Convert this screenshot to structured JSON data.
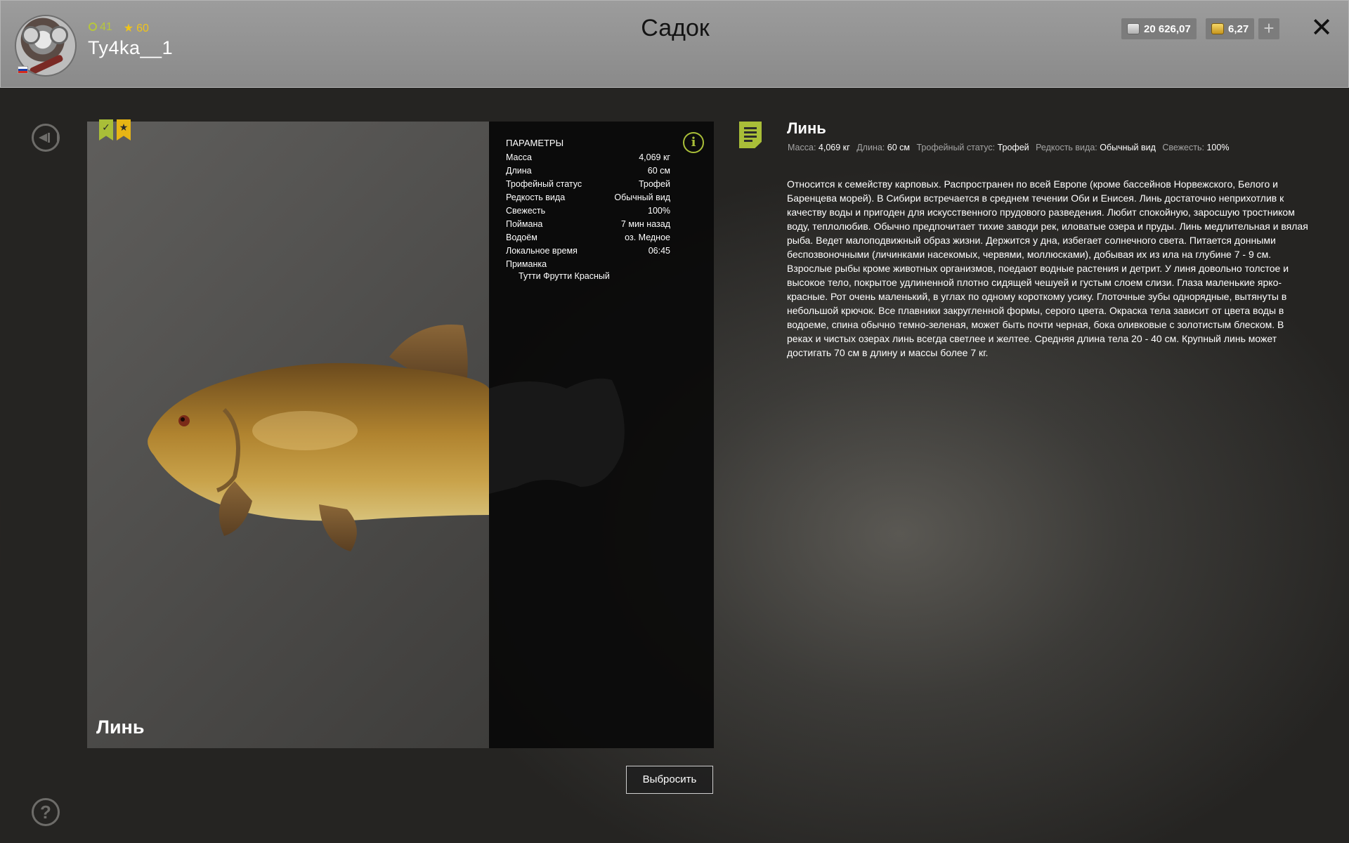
{
  "header": {
    "title": "Садок",
    "user": {
      "name": "Ty4ka__1",
      "level": "41",
      "rank": "60"
    },
    "currency": {
      "silver": "20 626,07",
      "gold": "6,27"
    },
    "plus_label": "+",
    "close_label": "✕"
  },
  "fish": {
    "name": "Линь",
    "params_title": "ПАРАМЕТРЫ",
    "params": [
      {
        "label": "Масса",
        "value": "4,069 кг"
      },
      {
        "label": "Длина",
        "value": "60 см"
      },
      {
        "label": "Трофейный статус",
        "value": "Трофей"
      },
      {
        "label": "Редкость вида",
        "value": "Обычный вид"
      },
      {
        "label": "Свежесть",
        "value": "100%"
      },
      {
        "label": "Поймана",
        "value": "7 мин назад"
      },
      {
        "label": "Водоём",
        "value": "оз. Медное"
      },
      {
        "label": "Локальное время",
        "value": "06:45"
      },
      {
        "label": "Приманка",
        "value": ""
      }
    ],
    "bait": "Тутти Фрутти Красный"
  },
  "description": {
    "title": "Линь",
    "meta": [
      {
        "label": "Масса:",
        "value": "4,069 кг"
      },
      {
        "label": "Длина:",
        "value": "60 см"
      },
      {
        "label": "Трофейный статус:",
        "value": "Трофей"
      },
      {
        "label": "Редкость вида:",
        "value": "Обычный вид"
      },
      {
        "label": "Свежесть:",
        "value": "100%"
      }
    ],
    "text": "Относится к семейству карповых. Распространен по всей Европе (кроме бассейнов Норвежского, Белого и Баренцева морей). В Сибири встречается в среднем течении Оби и Енисея. Линь достаточно неприхотлив к качеству воды и пригоден для искусственного прудового разведения. Любит спокойную, заросшую тростником воду, теплолюбив. Обычно предпочитает тихие заводи рек, иловатые озера и пруды. Линь медлительная и вялая рыба. Ведет малоподвижный образ жизни. Держится у дна, избегает солнечного света. Питается донными беспозвоночными (личинками насекомых, червями, моллюсками), добывая их из ила на глубине 7 - 9 см. Взрослые рыбы кроме животных организмов, поедают водные растения и детрит. У линя довольно толстое и высокое тело, покрытое удлиненной плотно сидящей чешуей и густым слоем слизи. Глаза маленькие ярко-красные. Рот очень маленький, в углах по одному короткому усику. Глоточные зубы однорядные, вытянуты в небольшой крючок. Все плавники закругленной формы, серого цвета. Окраска тела зависит от цвета воды в водоеме, спина обычно темно-зеленая, может быть почти черная, бока оливковые с золотистым блеском. В реках и чистых озерах линь всегда светлее и желтее. Средняя длина тела 20 - 40 см. Крупный линь может достигать 70 см в длину и массы более 7 кг."
  },
  "actions": {
    "discard": "Выбросить"
  },
  "icons": {
    "back": "back-icon",
    "help": "help-icon",
    "info": "info-icon",
    "note": "note-icon",
    "caught_badge": "check-icon",
    "favorite_badge": "star-icon"
  },
  "colors": {
    "accent_green": "#a9be38",
    "accent_gold": "#e7b514"
  }
}
